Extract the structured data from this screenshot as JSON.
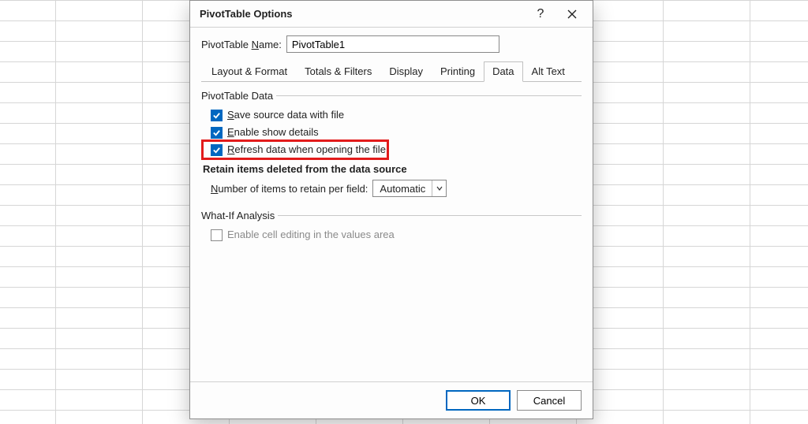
{
  "dialog": {
    "title": "PivotTable Options",
    "name_label_pre": "PivotTable ",
    "name_label_ul": "N",
    "name_label_post": "ame:",
    "name_value": "PivotTable1"
  },
  "tabs": [
    {
      "label": "Layout & Format",
      "active": false
    },
    {
      "label": "Totals & Filters",
      "active": false
    },
    {
      "label": "Display",
      "active": false
    },
    {
      "label": "Printing",
      "active": false
    },
    {
      "label": "Data",
      "active": true
    },
    {
      "label": "Alt Text",
      "active": false
    }
  ],
  "groups": {
    "pt_data": {
      "legend": "PivotTable Data",
      "save_ul": "S",
      "save_rest": "ave source data with file",
      "enable_ul": "E",
      "enable_rest": "nable show details",
      "refresh_ul": "R",
      "refresh_rest": "efresh data when opening the file",
      "retain_heading": "Retain items deleted from the data source",
      "retain_field_ul": "N",
      "retain_field_rest": "umber of items to retain per field:",
      "retain_value": "Automatic"
    },
    "whatif": {
      "legend": "What-If Analysis",
      "enable_cell": "Enable cell editing in the values area"
    }
  },
  "buttons": {
    "ok": "OK",
    "cancel": "Cancel"
  }
}
